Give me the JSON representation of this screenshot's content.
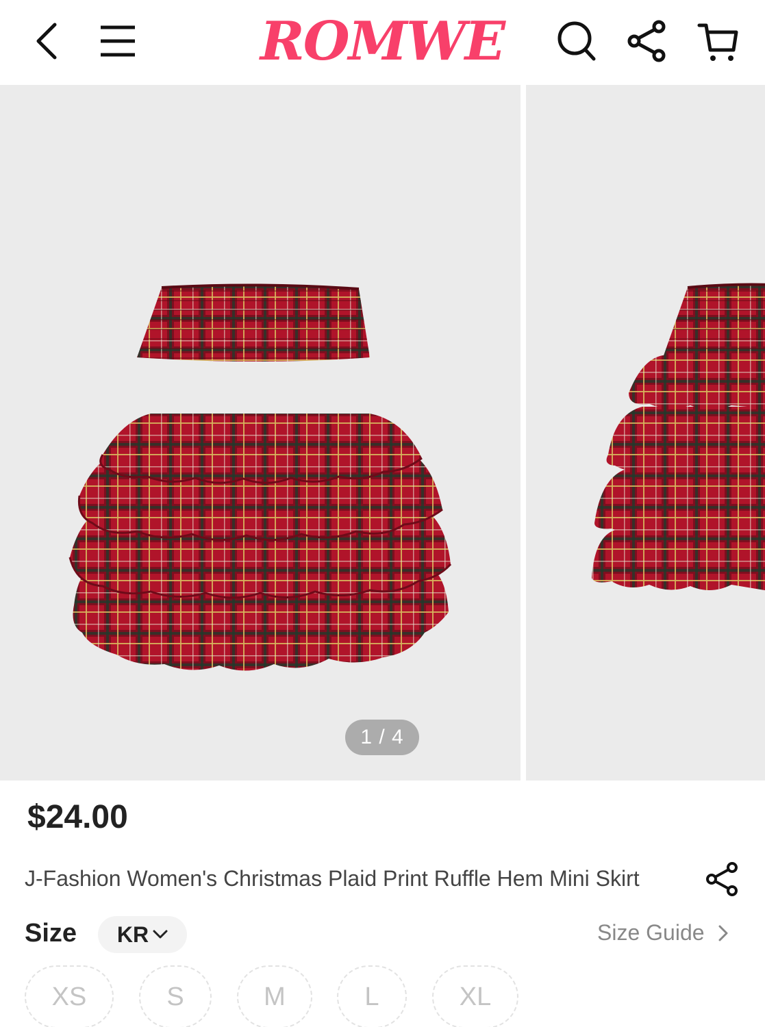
{
  "header": {
    "back_icon": "chevron-left-icon",
    "menu_icon": "hamburger-menu-icon",
    "logo_text": "ROMWE",
    "logo_color": "#f8406a",
    "search_icon": "search-icon",
    "share_icon": "share-icon",
    "cart_icon": "cart-icon"
  },
  "gallery": {
    "image_description_icon": "product-image",
    "counter": "1 / 4"
  },
  "product": {
    "price": "$24.00",
    "title": "J-Fashion Women's Christmas Plaid Print Ruffle Hem Mini Skirt",
    "share_icon": "share-icon"
  },
  "size_section": {
    "label": "Size",
    "region": "KR",
    "guide_label": "Size Guide",
    "options": [
      "XS",
      "S",
      "M",
      "L",
      "XL"
    ]
  }
}
